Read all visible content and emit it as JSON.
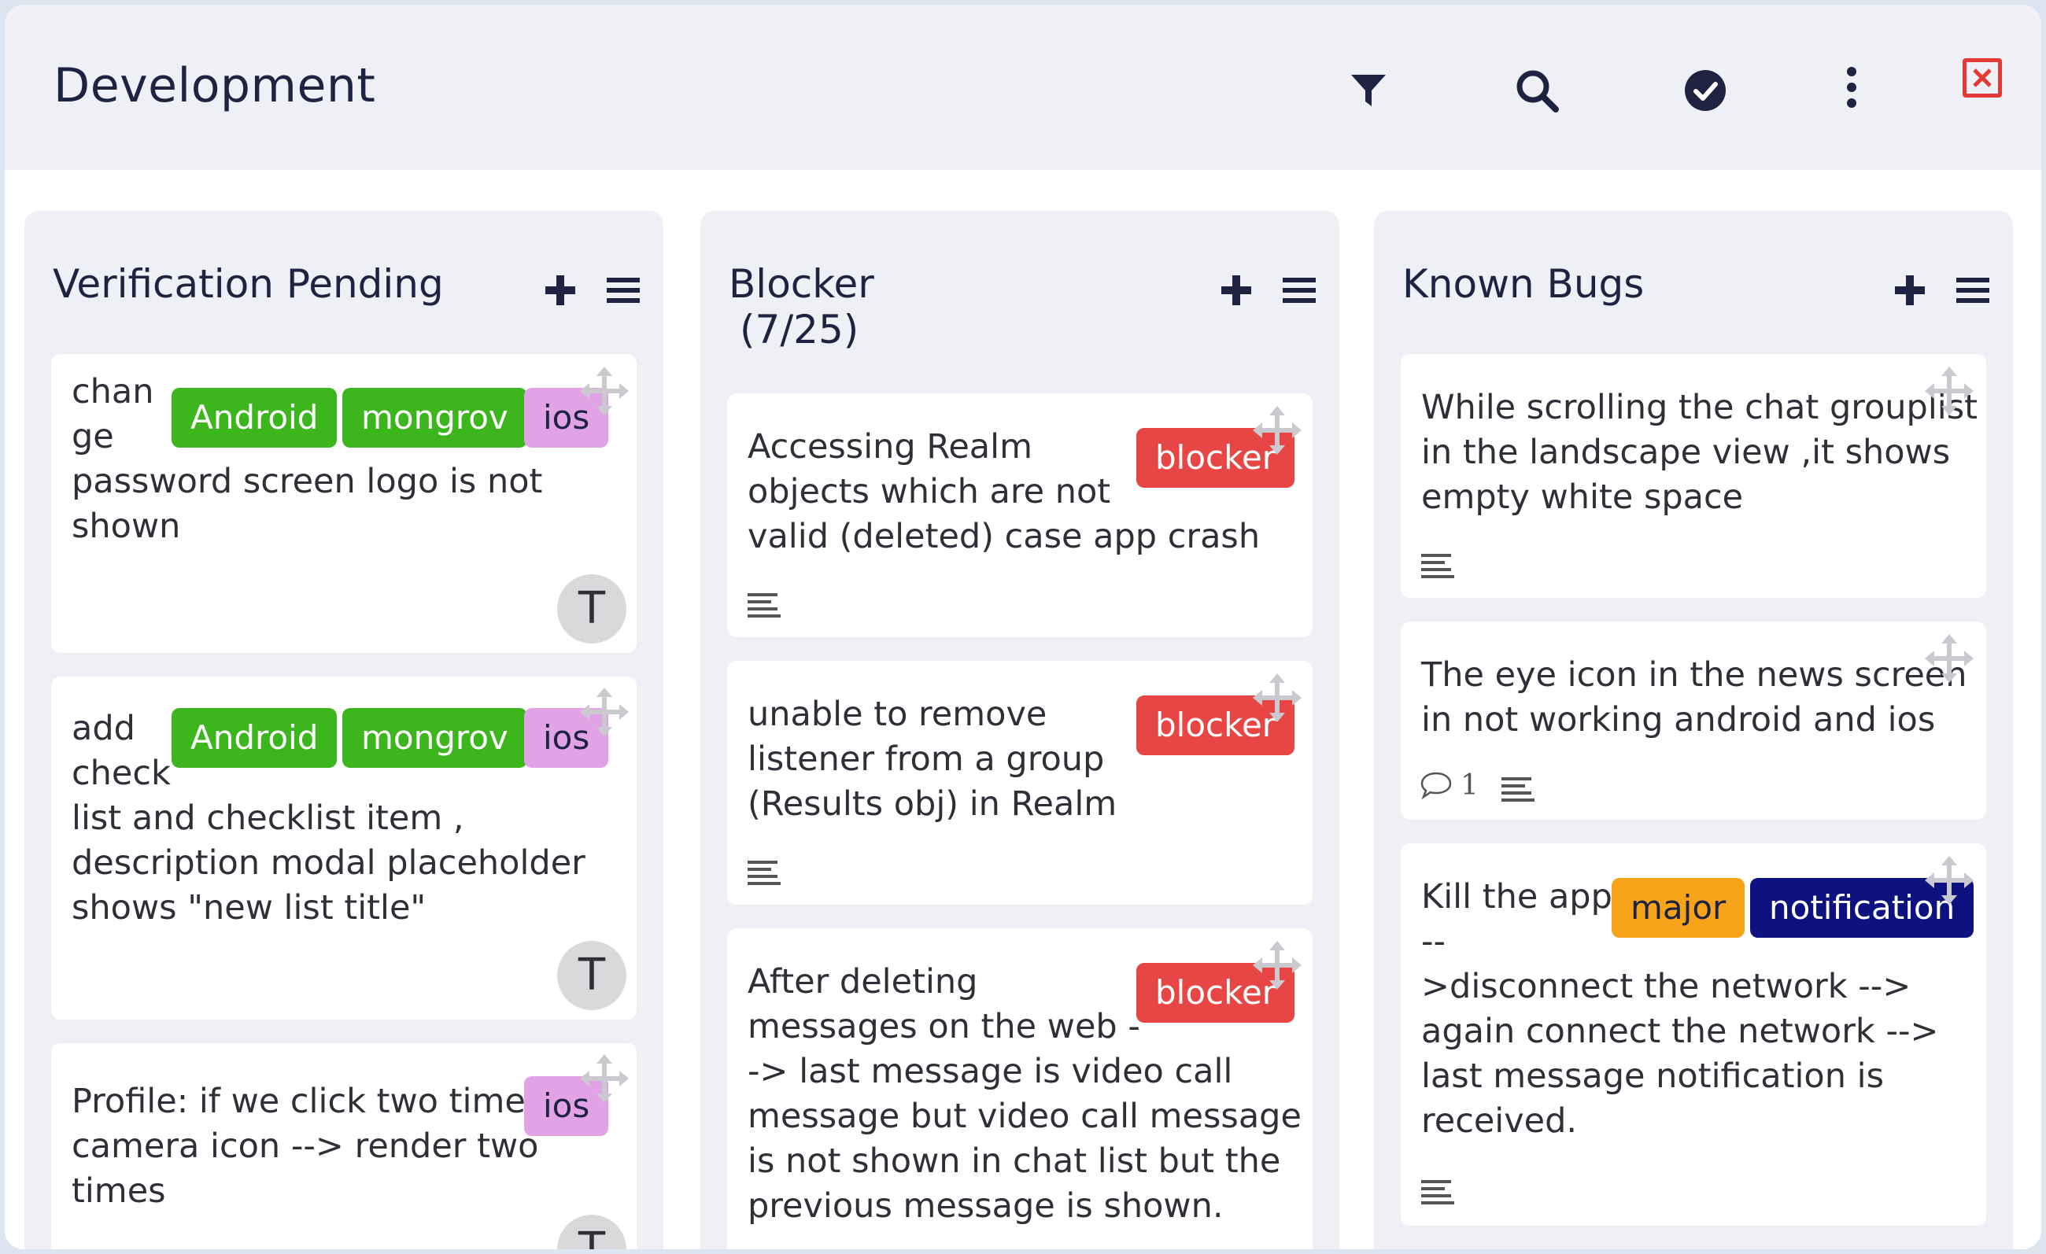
{
  "board": {
    "title": "Development",
    "toolbar_icons": [
      "filter-icon",
      "search-icon",
      "check-circle-icon",
      "more-vertical-icon",
      "close-icon"
    ]
  },
  "columns": [
    {
      "title": "Verification Pending",
      "cards": [
        {
          "text_lines": [
            "chan",
            "ge",
            "password screen logo is not",
            "shown"
          ],
          "tags": [
            "Android",
            "mongrov",
            "ios"
          ],
          "avatar": "T"
        },
        {
          "text_lines": [
            "add",
            "check",
            "list and checklist item ,",
            "description modal placeholder",
            "shows \"new list title\""
          ],
          "tags": [
            "Android",
            "mongrov",
            "ios"
          ],
          "avatar": "T"
        },
        {
          "text_lines": [
            "Profile: if we click two time",
            "camera icon --> render two",
            "times"
          ],
          "tags": [
            "ios"
          ],
          "avatar": "T"
        }
      ]
    },
    {
      "title_line1": "Blocker",
      "title_line2": "(7/25)",
      "cards": [
        {
          "text_lines": [
            "Accessing Realm",
            "objects which are not",
            "valid (deleted) case app crash"
          ],
          "tags": [
            "blocker"
          ]
        },
        {
          "text_lines": [
            "unable to remove",
            "listener from a group",
            "(Results obj) in Realm"
          ],
          "tags": [
            "blocker"
          ]
        },
        {
          "text_lines": [
            "After deleting",
            "messages on the web -",
            "-> last message is video call",
            "message but video call message",
            "is not shown in chat list but the",
            "previous message is shown."
          ],
          "tags": [
            "blocker"
          ]
        }
      ]
    },
    {
      "title": "Known Bugs",
      "cards": [
        {
          "text_lines": [
            "While scrolling the chat grouplist",
            "in the landscape view ,it shows",
            "empty white space"
          ],
          "tags": []
        },
        {
          "text_lines": [
            "The eye icon in the news screen",
            "in not working android and ios"
          ],
          "tags": [],
          "comments": "1"
        },
        {
          "text_lines": [
            "Kill the app",
            "--",
            ">disconnect the network -->",
            "again connect the network -->",
            "last message notification is",
            "received."
          ],
          "tags": [
            "major",
            "notification"
          ]
        }
      ]
    }
  ],
  "colors": {
    "green_tag": "#3db61d",
    "pink_tag": "#e2a3e6",
    "red_tag": "#e84545",
    "orange_tag": "#f7a41a",
    "navy_tag": "#0d1280",
    "close": "#e53935"
  }
}
